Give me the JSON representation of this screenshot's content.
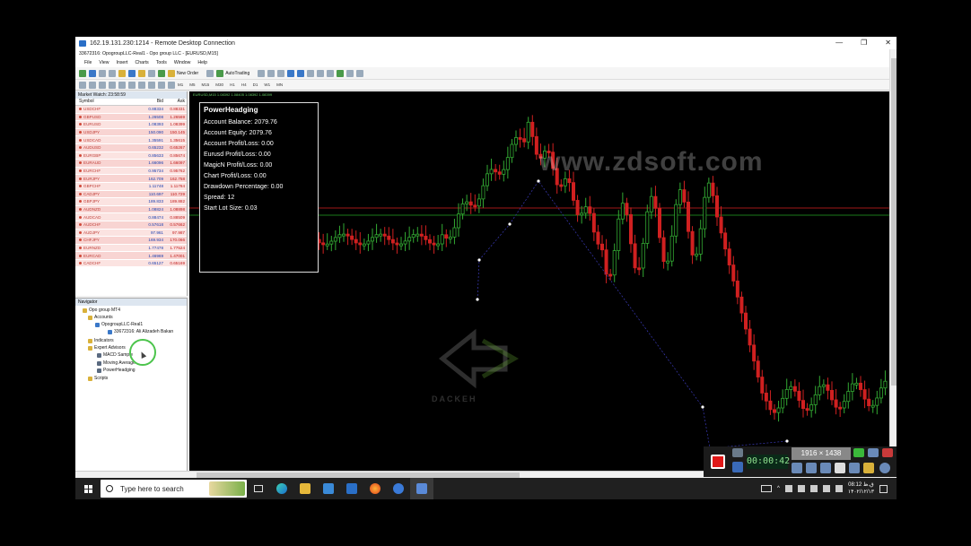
{
  "rdp": {
    "title": "162.19.131.230:1214 - Remote Desktop Connection",
    "min": "—",
    "max": "❐",
    "close": "✕"
  },
  "mt4": {
    "title": "33672316: OpogroupLLC-Real1 - Opo group LLC - [EURUSD,M15]",
    "menu": [
      "File",
      "View",
      "Insert",
      "Charts",
      "Tools",
      "Window",
      "Help"
    ],
    "new_order": "New Order",
    "auto_trading": "AutoTrading",
    "timeframes": [
      "M1",
      "M5",
      "M15",
      "M30",
      "H1",
      "H4",
      "D1",
      "W1",
      "MN"
    ]
  },
  "market_watch": {
    "header": "Market Watch: 23:58:59",
    "cols": {
      "symbol": "Symbol",
      "bid": "Bid",
      "ask": "Ask"
    },
    "rows": [
      {
        "symbol": "USDCHF",
        "bid": "0.88334",
        "ask": "0.88331"
      },
      {
        "symbol": "GBPUSD",
        "bid": "1.26508",
        "ask": "1.26569"
      },
      {
        "symbol": "EURUSD",
        "bid": "1.08393",
        "ask": "1.08399"
      },
      {
        "symbol": "USDJPY",
        "bid": "150.090",
        "ask": "150.145"
      },
      {
        "symbol": "USDCAD",
        "bid": "1.35591",
        "ask": "1.35615"
      },
      {
        "symbol": "AUDUSD",
        "bid": "0.65232",
        "ask": "0.65267"
      },
      {
        "symbol": "EURGBP",
        "bid": "0.85633",
        "ask": "0.85674"
      },
      {
        "symbol": "EURAUD",
        "bid": "1.66096",
        "ask": "1.66097"
      },
      {
        "symbol": "EURCHF",
        "bid": "0.95734",
        "ask": "0.95762"
      },
      {
        "symbol": "EURJPY",
        "bid": "162.709",
        "ask": "162.758"
      },
      {
        "symbol": "GBPCHF",
        "bid": "1.11748",
        "ask": "1.11784"
      },
      {
        "symbol": "CADJPY",
        "bid": "110.697",
        "ask": "110.729"
      },
      {
        "symbol": "GBPJPY",
        "bid": "189.833",
        "ask": "189.882"
      },
      {
        "symbol": "AUDNZD",
        "bid": "1.08824",
        "ask": "1.08898"
      },
      {
        "symbol": "AUDCAD",
        "bid": "0.88474",
        "ask": "0.88509"
      },
      {
        "symbol": "AUDCHF",
        "bid": "0.57618",
        "ask": "0.57662"
      },
      {
        "symbol": "AUDJPY",
        "bid": "97.961",
        "ask": "97.987"
      },
      {
        "symbol": "CHFJPY",
        "bid": "169.934",
        "ask": "170.066"
      },
      {
        "symbol": "EURNZD",
        "bid": "1.77478",
        "ask": "1.77524"
      },
      {
        "symbol": "EURCAD",
        "bid": "1.46969",
        "ask": "1.47001"
      },
      {
        "symbol": "CADCHF",
        "bid": "0.65127",
        "ask": "0.65169"
      }
    ],
    "tabs": [
      "Symbols",
      "Tick Chart"
    ]
  },
  "navigator": {
    "header": "Navigator",
    "root": "Opo group MT4",
    "accounts": "Accounts",
    "server": "OpogroupLLC-Real1",
    "account": "33672316: Ali Alizadeh Bakan",
    "indicators": "Indicators",
    "experts": "Expert Advisors",
    "ea": [
      "MACD Sample",
      "Moving Average",
      "PowerHeadging"
    ],
    "scripts": "Scripts"
  },
  "chart": {
    "header": "EURUSD,M15  1.08392 1.08405 1.08392 1.08399",
    "watermark": "www.zdsoft.com",
    "logo": "DACKEH",
    "colors": {
      "bull": "#33aa33",
      "bear": "#d02020",
      "red_line": "#a01818",
      "green_line": "#1a7a1a"
    }
  },
  "panel": {
    "title": "PowerHeadging",
    "lines": [
      "Account Balance: 2079.76",
      "Account Equity: 2079.76",
      "Account Profit/Loss: 0.00",
      "Eurusd Profit/Loss: 0.00",
      "MagicN Profit/Loss: 0.00",
      "Chart Profit/Loss: 0.00",
      "Drawdown Percentage: 0.00",
      "Spread: 12",
      "Start Lot Size: 0.03"
    ]
  },
  "recorder": {
    "timer": "00:00:42",
    "resolution": "1916 × 1438"
  },
  "taskbar": {
    "search_placeholder": "Type here to search",
    "time": "08:12 ق.ظ",
    "date": "۱۴۰۲/۱۲/۱۳"
  }
}
